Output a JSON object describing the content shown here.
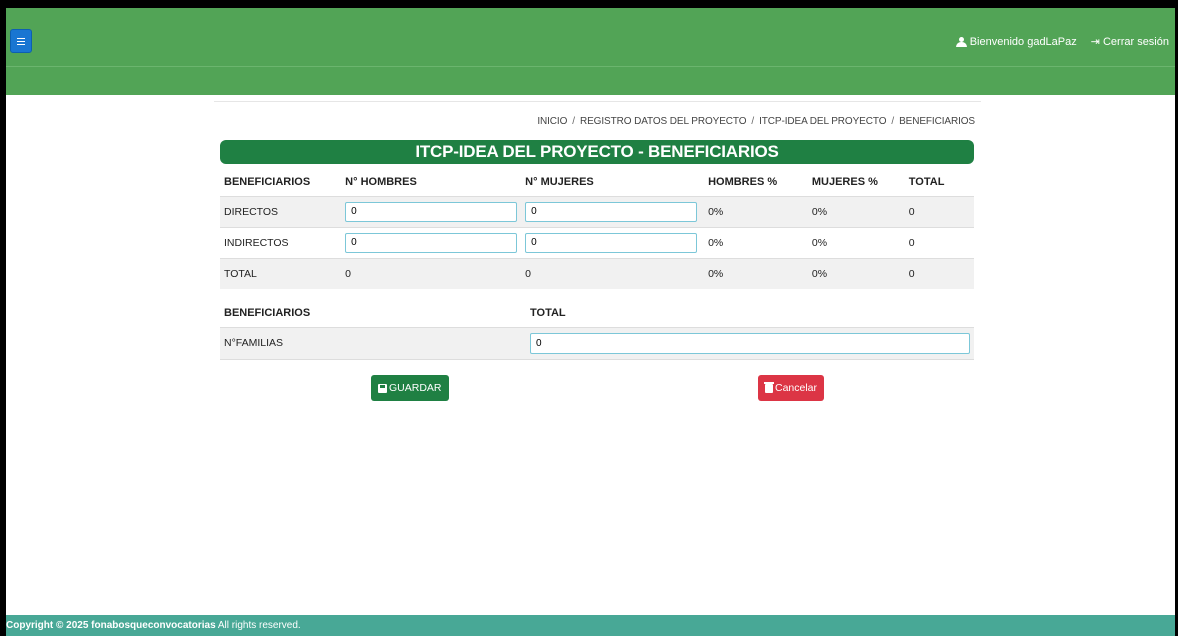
{
  "header": {
    "menu_icon": "hamburger-icon",
    "welcome": "Bienvenido gadLaPaz",
    "logout": "Cerrar sesión",
    "colors": {
      "topbar": "#52a456",
      "menu_button": "#1976d2"
    }
  },
  "breadcrumb": {
    "items": [
      "INICIO",
      "REGISTRO DATOS DEL PROYECTO",
      "ITCP-IDEA DEL PROYECTO",
      "BENEFICIARIOS"
    ],
    "separator": "/"
  },
  "title": "ITCP-IDEA DEL PROYECTO - BENEFICIARIOS",
  "table": {
    "headers": [
      "BENEFICIARIOS",
      "N° HOMBRES",
      "N° MUJERES",
      "HOMBRES %",
      "MUJERES %",
      "TOTAL"
    ],
    "rows": [
      {
        "label": "DIRECTOS",
        "hombres": "0",
        "mujeres": "0",
        "hombres_pct": "0%",
        "mujeres_pct": "0%",
        "total": "0"
      },
      {
        "label": "INDIRECTOS",
        "hombres": "0",
        "mujeres": "0",
        "hombres_pct": "0%",
        "mujeres_pct": "0%",
        "total": "0"
      },
      {
        "label": "TOTAL",
        "hombres": "0",
        "mujeres": "0",
        "hombres_pct": "0%",
        "mujeres_pct": "0%",
        "total": "0"
      }
    ]
  },
  "families": {
    "headers": [
      "BENEFICIARIOS",
      "TOTAL"
    ],
    "label": "N°FAMILIAS",
    "value": "0"
  },
  "buttons": {
    "save": "GUARDAR",
    "cancel": "Cancelar",
    "colors": {
      "save": "#1f8043",
      "cancel": "#dc3545"
    }
  },
  "footer": {
    "copyright": "Copyright © 2025 fonabosqueconvocatorias",
    "rights": "All rights reserved."
  }
}
